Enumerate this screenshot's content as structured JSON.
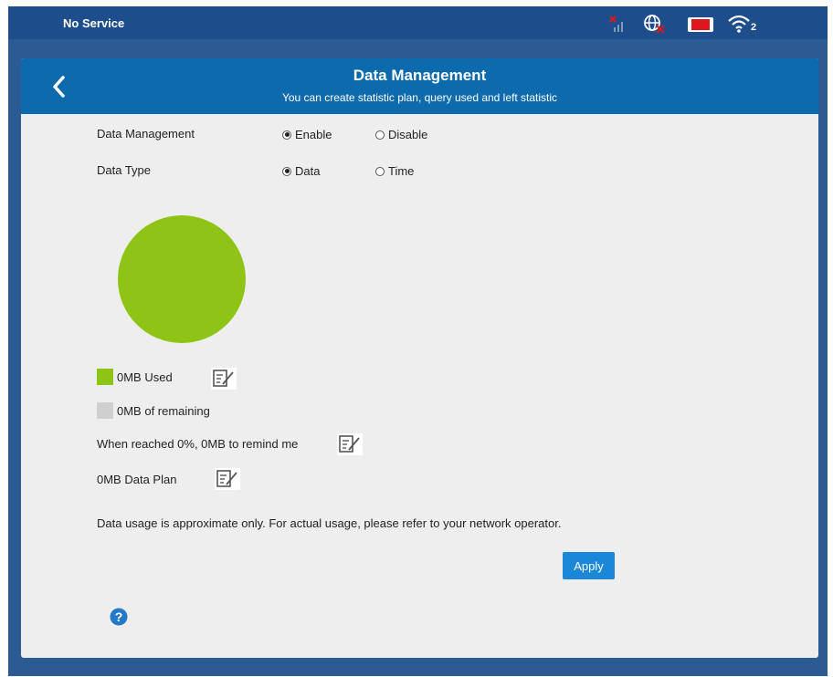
{
  "topbar": {
    "service_text": "No Service",
    "wifi_clients": "2",
    "icons": [
      "no-signal-icon",
      "internet-disconnected-icon",
      "sim-card-icon",
      "wifi-icon"
    ]
  },
  "header": {
    "title": "Data Management",
    "subtitle": "You can create statistic plan, query used and left statistic"
  },
  "form": {
    "data_management": {
      "label": "Data Management",
      "options": [
        "Enable",
        "Disable"
      ],
      "selected": "Enable"
    },
    "data_type": {
      "label": "Data Type",
      "options": [
        "Data",
        "Time"
      ],
      "selected": "Data"
    }
  },
  "usage": {
    "used_fraction": 1.0,
    "used_color": "#8dc416",
    "remaining_color": "#cfcfcf",
    "used_label": "0MB Used",
    "remaining_label": "0MB of remaining",
    "remind_text": "When reached 0%, 0MB to remind me",
    "plan_text": "0MB Data Plan",
    "note": "Data usage is approximate only. For actual usage, please refer to your network operator."
  },
  "buttons": {
    "apply": "Apply"
  },
  "colors": {
    "topbar": "#1e4d8c",
    "header": "#0d6aad",
    "accent": "#1a87d9",
    "sim": "#e0161f"
  }
}
